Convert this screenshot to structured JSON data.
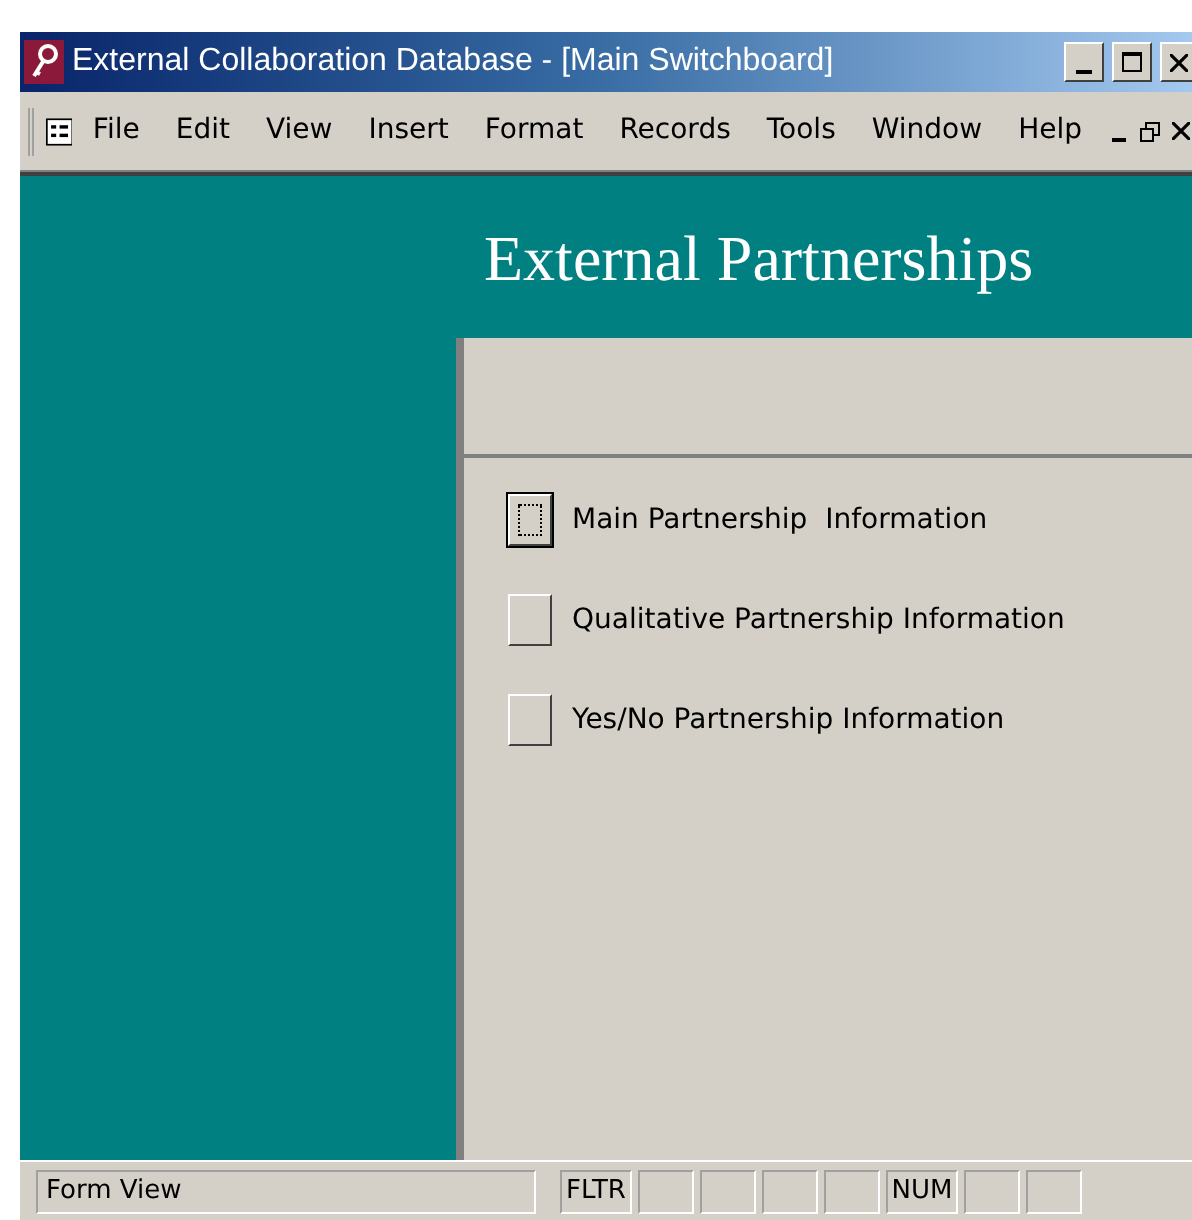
{
  "window": {
    "title": "External Collaboration Database - [Main Switchboard]"
  },
  "menu": [
    "File",
    "Edit",
    "View",
    "Insert",
    "Format",
    "Records",
    "Tools",
    "Window",
    "Help"
  ],
  "form": {
    "title": "External Partnerships",
    "items": [
      {
        "label": "Main Partnership  Information",
        "selected": true
      },
      {
        "label": "Qualitative Partnership Information",
        "selected": false
      },
      {
        "label": "Yes/No Partnership Information",
        "selected": false
      }
    ]
  },
  "status_bar": {
    "mode": "Form View",
    "indicators": [
      "FLTR",
      "NUM"
    ]
  }
}
